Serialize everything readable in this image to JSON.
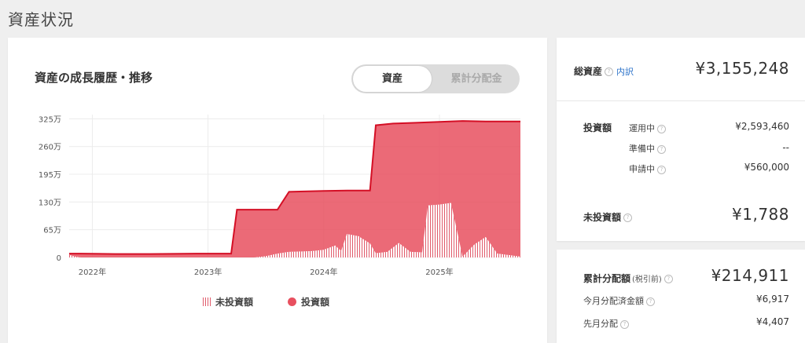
{
  "page": {
    "title": "資産状況"
  },
  "chart_card": {
    "title": "資産の成長履歴・推移",
    "toggle": {
      "active": "資産",
      "inactive": "累計分配金"
    }
  },
  "chart_data": {
    "type": "area",
    "y_ticks": [
      "0",
      "65万",
      "130万",
      "195万",
      "260万",
      "325万"
    ],
    "y_tick_values": [
      0,
      65,
      130,
      195,
      260,
      325
    ],
    "ylim": [
      0,
      335
    ],
    "xlim": [
      2021.8,
      2025.7
    ],
    "x_ticks": [
      "2022年",
      "2023年",
      "2024年",
      "2025年"
    ],
    "x_tick_values": [
      2022.0,
      2023.0,
      2024.0,
      2025.0
    ],
    "grid": true,
    "legend_position": "bottom",
    "series": [
      {
        "name": "投資額",
        "color": "#e8505f",
        "style": "area",
        "points": [
          [
            2021.8,
            9
          ],
          [
            2021.9,
            9
          ],
          [
            2022.2,
            8
          ],
          [
            2022.5,
            8
          ],
          [
            2022.9,
            9
          ],
          [
            2023.2,
            9
          ],
          [
            2023.25,
            112
          ],
          [
            2023.6,
            112
          ],
          [
            2023.7,
            154
          ],
          [
            2024.0,
            156
          ],
          [
            2024.2,
            157
          ],
          [
            2024.4,
            157
          ],
          [
            2024.45,
            310
          ],
          [
            2024.6,
            314
          ],
          [
            2024.8,
            316
          ],
          [
            2025.0,
            318
          ],
          [
            2025.2,
            320
          ],
          [
            2025.4,
            319
          ],
          [
            2025.7,
            319
          ]
        ]
      },
      {
        "name": "未投資額",
        "color": "#e05a6a",
        "style": "hatch",
        "points": [
          [
            2021.8,
            6
          ],
          [
            2021.85,
            2
          ],
          [
            2021.9,
            0
          ],
          [
            2023.4,
            0
          ],
          [
            2023.5,
            3
          ],
          [
            2023.6,
            9
          ],
          [
            2023.7,
            13
          ],
          [
            2023.9,
            15
          ],
          [
            2024.0,
            18
          ],
          [
            2024.1,
            28
          ],
          [
            2024.15,
            15
          ],
          [
            2024.2,
            55
          ],
          [
            2024.3,
            50
          ],
          [
            2024.4,
            33
          ],
          [
            2024.45,
            10
          ],
          [
            2024.55,
            13
          ],
          [
            2024.65,
            34
          ],
          [
            2024.75,
            13
          ],
          [
            2024.85,
            12
          ],
          [
            2024.9,
            122
          ],
          [
            2025.0,
            124
          ],
          [
            2025.1,
            128
          ],
          [
            2025.2,
            2
          ],
          [
            2025.3,
            30
          ],
          [
            2025.4,
            48
          ],
          [
            2025.5,
            9
          ],
          [
            2025.7,
            2
          ]
        ]
      }
    ]
  },
  "summary": {
    "total_label": "総資産",
    "breakdown_link": "内訳",
    "total_value": "¥3,155,248",
    "invested_label": "投資額",
    "operating_label": "運用中",
    "operating_value": "¥2,593,460",
    "preparing_label": "準備中",
    "preparing_value": "--",
    "applying_label": "申請中",
    "applying_value": "¥560,000",
    "uninvested_label": "未投資額",
    "uninvested_value": "¥1,788"
  },
  "distribution": {
    "total_label": "累計分配額",
    "total_note": "(税引前)",
    "total_value": "¥214,911",
    "this_month_label": "今月分配済金額",
    "this_month_value": "¥6,917",
    "last_month_label": "先月分配",
    "last_month_value": "¥4,407"
  },
  "icons": {
    "help": "question-circle-icon"
  }
}
